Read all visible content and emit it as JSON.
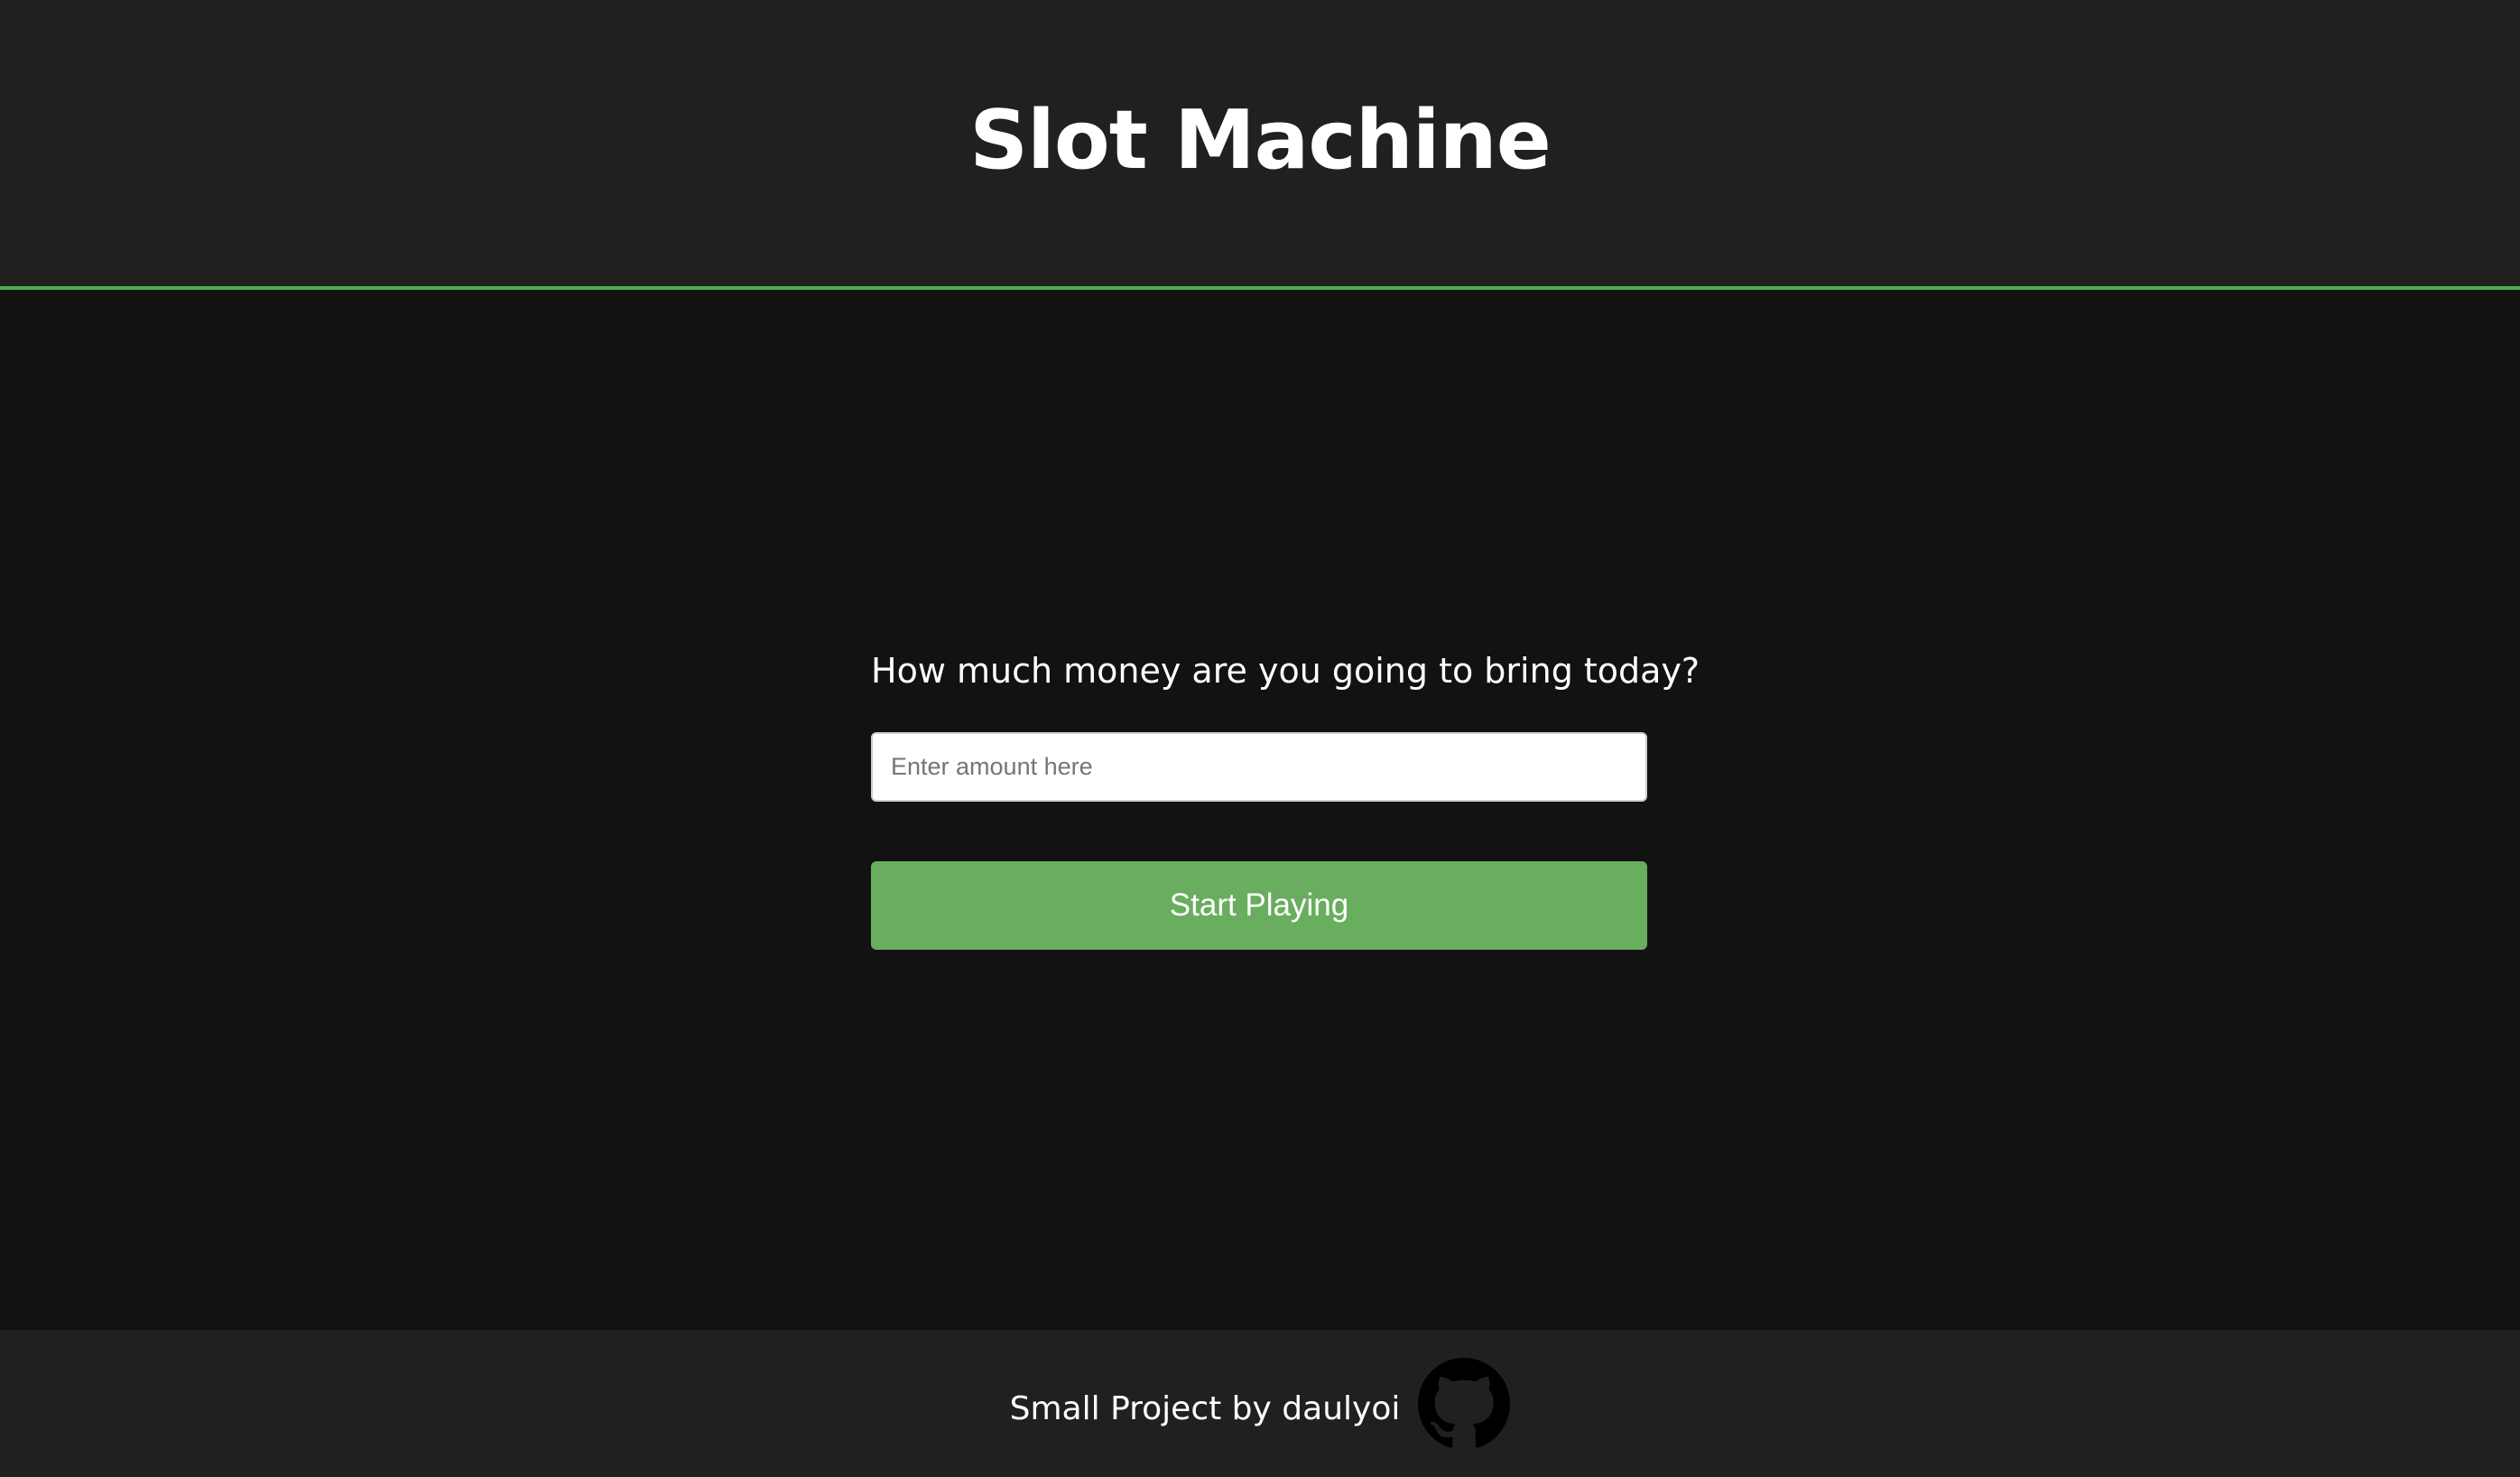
{
  "header": {
    "title": "Slot Machine"
  },
  "main": {
    "question": "How much money are you going to bring today?",
    "amount_input": {
      "value": "",
      "placeholder": "Enter amount here"
    },
    "start_button_label": "Start Playing"
  },
  "footer": {
    "text": "Small Project by daulyoi",
    "github_icon": "github-icon"
  },
  "colors": {
    "header_background": "#202020",
    "main_background": "#121212",
    "accent_green": "#4caf50",
    "button_green": "#69ad5f",
    "text": "#ffffff",
    "icon": "#000000"
  }
}
